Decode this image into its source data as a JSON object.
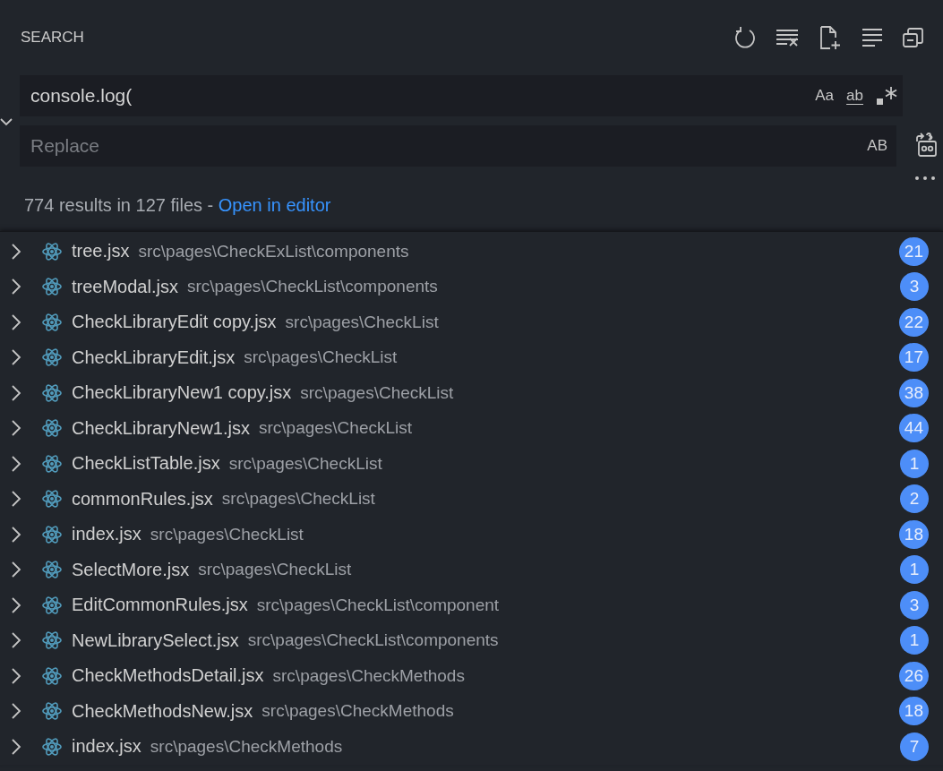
{
  "panel": {
    "title": "SEARCH"
  },
  "search": {
    "value": "console.log(",
    "options": [
      "Aa",
      "ab"
    ]
  },
  "replace": {
    "expanded": true,
    "placeholder": "Replace",
    "option": "AB"
  },
  "summary": {
    "text": "774 results in 127 files - ",
    "link": "Open in editor"
  },
  "results": [
    {
      "file": "tree.jsx",
      "path": "src\\pages\\CheckExList\\components",
      "count": "21",
      "expanded": false
    },
    {
      "file": "treeModal.jsx",
      "path": "src\\pages\\CheckList\\components",
      "count": "3",
      "expanded": false
    },
    {
      "file": "CheckLibraryEdit copy.jsx",
      "path": "src\\pages\\CheckList",
      "count": "22",
      "expanded": false
    },
    {
      "file": "CheckLibraryEdit.jsx",
      "path": "src\\pages\\CheckList",
      "count": "17",
      "expanded": false
    },
    {
      "file": "CheckLibraryNew1 copy.jsx",
      "path": "src\\pages\\CheckList",
      "count": "38",
      "expanded": false
    },
    {
      "file": "CheckLibraryNew1.jsx",
      "path": "src\\pages\\CheckList",
      "count": "44",
      "expanded": false
    },
    {
      "file": "CheckListTable.jsx",
      "path": "src\\pages\\CheckList",
      "count": "1",
      "expanded": false
    },
    {
      "file": "commonRules.jsx",
      "path": "src\\pages\\CheckList",
      "count": "2",
      "expanded": false
    },
    {
      "file": "index.jsx",
      "path": "src\\pages\\CheckList",
      "count": "18",
      "expanded": false
    },
    {
      "file": "SelectMore.jsx",
      "path": "src\\pages\\CheckList",
      "count": "1",
      "expanded": false
    },
    {
      "file": "EditCommonRules.jsx",
      "path": "src\\pages\\CheckList\\component",
      "count": "3",
      "expanded": false
    },
    {
      "file": "NewLibrarySelect.jsx",
      "path": "src\\pages\\CheckList\\components",
      "count": "1",
      "expanded": false
    },
    {
      "file": "CheckMethodsDetail.jsx",
      "path": "src\\pages\\CheckMethods",
      "count": "26",
      "expanded": false
    },
    {
      "file": "CheckMethodsNew.jsx",
      "path": "src\\pages\\CheckMethods",
      "count": "18",
      "expanded": false
    },
    {
      "file": "index.jsx",
      "path": "src\\pages\\CheckMethods",
      "count": "7",
      "expanded": false
    }
  ]
}
